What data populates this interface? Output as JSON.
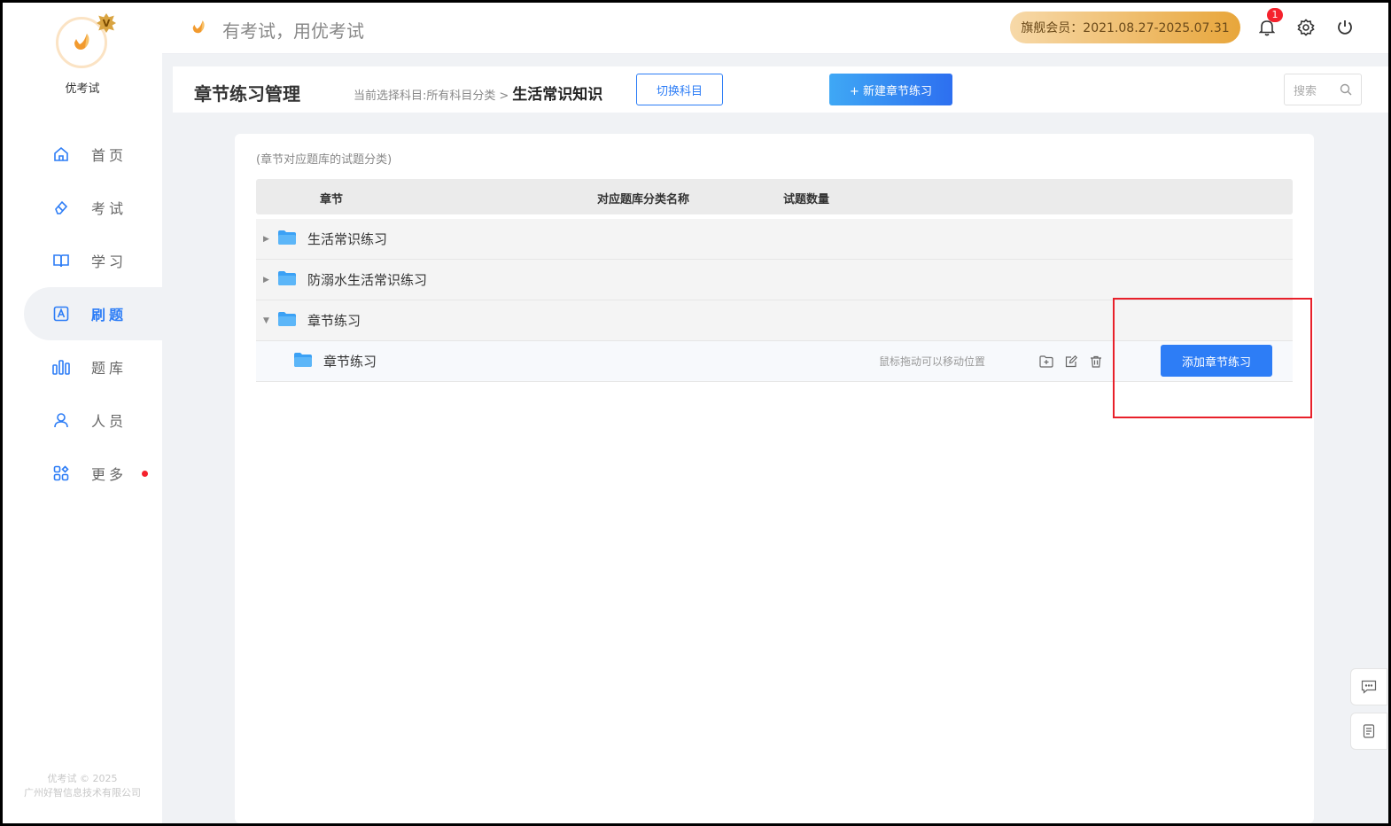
{
  "app": {
    "name": "优考试",
    "slogan": "有考试，用优考试",
    "copyright_line1": "优考试 © 2025",
    "copyright_line2": "广州好智信息技术有限公司"
  },
  "sidebar": {
    "items": [
      {
        "label": "首页",
        "icon": "home-icon"
      },
      {
        "label": "考试",
        "icon": "eraser-icon"
      },
      {
        "label": "学习",
        "icon": "book-icon"
      },
      {
        "label": "刷题",
        "icon": "letter-a-icon",
        "active": true
      },
      {
        "label": "题库",
        "icon": "bars-icon"
      },
      {
        "label": "人员",
        "icon": "user-icon"
      },
      {
        "label": "更多",
        "icon": "apps-icon",
        "has_dot": true
      }
    ]
  },
  "topbar": {
    "membership": "旗舰会员：2021.08.27-2025.07.31",
    "notification_count": "1"
  },
  "header": {
    "title": "章节练习管理",
    "crumb_prefix": "当前选择科目:所有科目分类",
    "crumb_sep": ">",
    "crumb_current": "生活常识知识",
    "switch_label": "切换科目",
    "new_label": "+ 新建章节练习",
    "search_placeholder": "搜索"
  },
  "content": {
    "hint": "(章节对应题库的试题分类)",
    "columns": [
      "章节",
      "对应题库分类名称",
      "试题数量"
    ],
    "rows": [
      {
        "label": "生活常识练习",
        "expanded": false
      },
      {
        "label": "防溺水生活常识练习",
        "expanded": false
      },
      {
        "label": "章节练习",
        "expanded": true
      }
    ],
    "child_row": {
      "label": "章节练习",
      "drag_hint": "鼠标拖动可以移动位置",
      "add_label": "添加章节练习"
    }
  },
  "colors": {
    "primary": "#2d7df6",
    "highlight_box": "#e8202a",
    "member_gold": "#e8a63b",
    "folder": "#3ba1f5"
  }
}
